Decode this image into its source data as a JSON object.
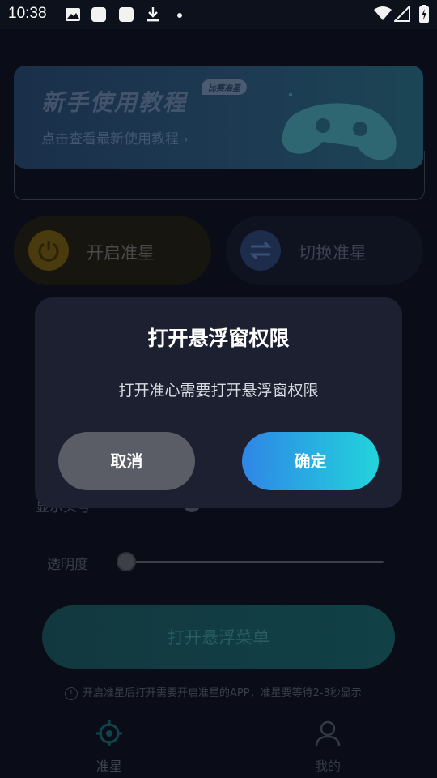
{
  "status_bar": {
    "time": "10:38",
    "icons": [
      "image-icon",
      "app-icon",
      "app-icon",
      "download-icon",
      "dot-icon",
      "wifi-icon",
      "signal-icon",
      "battery-charging-icon"
    ]
  },
  "banner": {
    "title": "新手使用教程",
    "tag": "比赛准星",
    "subtitle": "点击查看最新使用教程 ›"
  },
  "actions": {
    "power_label": "开启准星",
    "switch_label": "切换准星"
  },
  "settings": {
    "show_label": "显示头号",
    "opacity_label": "透明度",
    "opacity_value": 0
  },
  "float_button_label": "打开悬浮菜单",
  "notice": "开启准星后打开需要开启准星的APP，准星要等待2-3秒显示",
  "tabs": [
    {
      "label": "准星",
      "active": true
    },
    {
      "label": "我的",
      "active": false
    }
  ],
  "dialog": {
    "title": "打开悬浮窗权限",
    "message": "打开准心需要打开悬浮窗权限",
    "cancel_label": "取消",
    "confirm_label": "确定"
  },
  "colors": {
    "dialog_bg": "#1d2030",
    "cancel_bg": "#5b5d66",
    "confirm_gradient_start": "#2f86e6",
    "confirm_gradient_end": "#22d4dc",
    "app_bg": "#0a0d18"
  }
}
